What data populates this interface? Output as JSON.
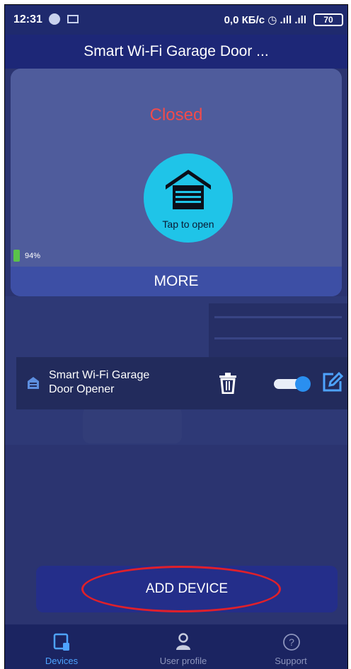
{
  "status_bar": {
    "time": "12:31",
    "network_speed": "0,0 КБ/с",
    "battery": "70"
  },
  "app_bar": {
    "title": "Smart Wi-Fi Garage Door ..."
  },
  "control_card": {
    "status": "Closed",
    "tap_label": "Tap to open",
    "battery_percent": "94%",
    "more_label": "MORE"
  },
  "device": {
    "name": "Smart Wi-Fi Garage Door Opener",
    "enabled": true
  },
  "actions": {
    "add_device": "ADD DEVICE"
  },
  "bottom_nav": {
    "items": [
      {
        "label": "Devices",
        "active": true,
        "icon": "devices-icon"
      },
      {
        "label": "User profile",
        "active": false,
        "icon": "user-icon"
      },
      {
        "label": "Support",
        "active": false,
        "icon": "help-icon"
      }
    ]
  },
  "colors": {
    "background": "#2b3470",
    "status_closed": "#f24b4b",
    "door_button": "#1fc4e8",
    "accent": "#4ea3ff",
    "annotation": "#e0202a"
  }
}
